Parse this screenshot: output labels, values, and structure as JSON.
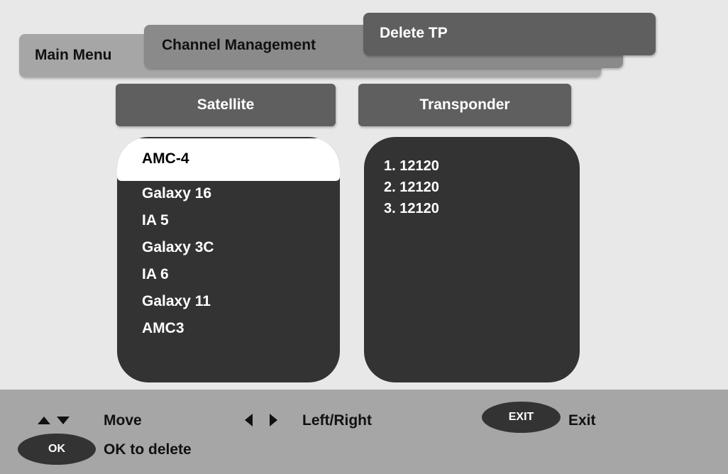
{
  "breadcrumb": {
    "main_menu": "Main Menu",
    "channel_management": "Channel Management",
    "delete_tp": "Delete TP"
  },
  "columns": {
    "satellite": "Satellite",
    "transponder": "Transponder"
  },
  "satellites": [
    "AMC-4",
    "Galaxy 16",
    "IA 5",
    "Galaxy 3C",
    "IA 6",
    "Galaxy 11",
    "AMC3"
  ],
  "selected_satellite_index": 0,
  "transponders": [
    "1. 12120",
    "2. 12120",
    "3. 12120"
  ],
  "help": {
    "move": "Move",
    "left_right": "Left/Right",
    "exit_key": "EXIT",
    "exit": "Exit",
    "ok_key": "OK",
    "ok_to_delete": "OK to delete"
  },
  "icons": {
    "up": "triangle-up-icon",
    "down": "triangle-down-icon",
    "left": "triangle-left-icon",
    "right": "triangle-right-icon"
  },
  "colors": {
    "background": "#e8e8e8",
    "panel_dark": "#333333",
    "header": "#5f5f5f",
    "tab_mid": "#8a8a8a",
    "tab_light": "#a6a6a6",
    "selected": "#ffffff"
  }
}
